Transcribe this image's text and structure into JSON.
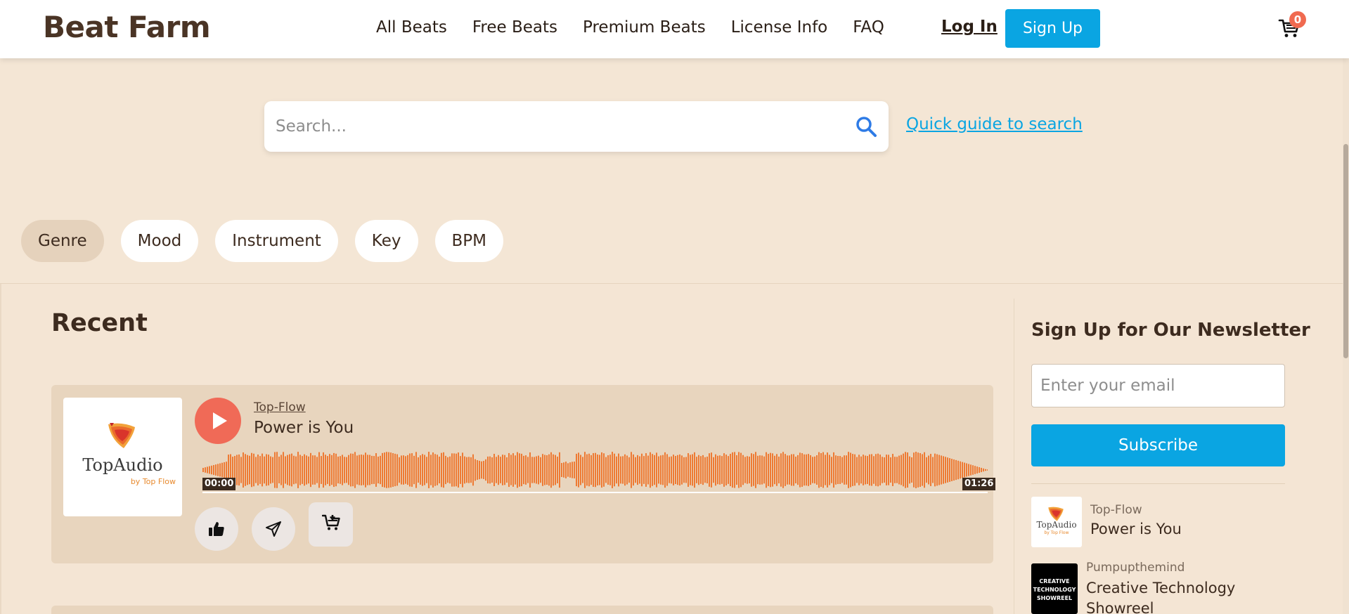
{
  "header": {
    "logo": "Beat Farm",
    "nav": [
      {
        "label": "All Beats"
      },
      {
        "label": "Free Beats"
      },
      {
        "label": "Premium Beats"
      },
      {
        "label": "License Info"
      },
      {
        "label": "FAQ"
      }
    ],
    "login_label": "Log In",
    "signup_label": "Sign Up",
    "cart_count": "0"
  },
  "search": {
    "placeholder": "Search...",
    "value": "",
    "guide_link": "Quick guide to search"
  },
  "filters": [
    {
      "label": "Genre",
      "active": true
    },
    {
      "label": "Mood",
      "active": false
    },
    {
      "label": "Instrument",
      "active": false
    },
    {
      "label": "Key",
      "active": false
    },
    {
      "label": "BPM",
      "active": false
    }
  ],
  "recent": {
    "title": "Recent",
    "tracks": [
      {
        "artist": "Top-Flow",
        "title": "Power is You",
        "cover_name": "TopAudio",
        "cover_sub": "by Top Flow",
        "time_start": "00:00",
        "time_end": "01:26"
      }
    ]
  },
  "newsletter": {
    "title": "Sign Up for Our Newsletter",
    "email_placeholder": "Enter your email",
    "email_value": "",
    "subscribe_label": "Subscribe",
    "items": [
      {
        "artist": "Top-Flow",
        "title": "Power is You",
        "thumb_name": "TopAudio",
        "thumb_sub": "by Top Flow"
      },
      {
        "artist": "Pumpupthemind",
        "title": "Creative Technology Showreel",
        "thumb_text": "CREATIVE TECHNOLOGY SHOWREEL"
      }
    ]
  },
  "colors": {
    "accent": "#0aa5e2",
    "play": "#f06a57",
    "waveform": "#ee7a33",
    "background": "#f4e6d5",
    "card": "#e8d5be"
  },
  "icons": {
    "search": "search-icon",
    "cart": "cart-icon",
    "like": "thumbs-up-icon",
    "share": "send-icon",
    "add_to_cart": "cart-plus-icon",
    "play": "play-icon"
  }
}
